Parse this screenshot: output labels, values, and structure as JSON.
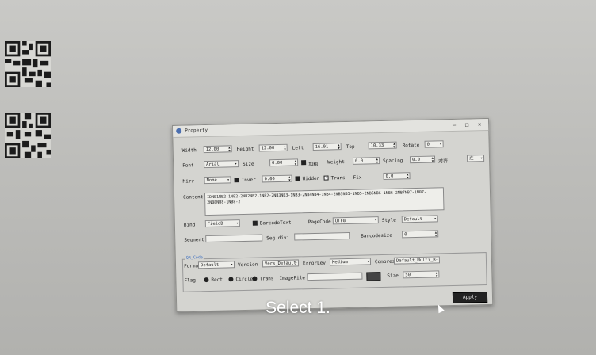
{
  "window": {
    "title": "Property",
    "min": "–",
    "max": "□",
    "close": "×"
  },
  "row1": {
    "width_label": "Width",
    "width_value": "12.00",
    "height_label": "Height",
    "height_value": "12.00",
    "left_label": "Left",
    "left_value": "16.01",
    "top_label": "Top",
    "top_value": "10.33",
    "rotate_label": "Rotate",
    "rotate_value": "0"
  },
  "row2": {
    "font_label": "Font",
    "font_value": "Arial",
    "size_label": "Size",
    "size_value": "0.00",
    "bold_label": "加粗",
    "weight_label": "Weight",
    "weight_value": "0.0",
    "spacing_label": "Spacing",
    "spacing_value": "0.0",
    "align_label": "对齐",
    "align_value": "左"
  },
  "row3": {
    "mirr_label": "Mirr",
    "mirr_value": "None",
    "inver_label": "Inver",
    "inver_value": "0.00",
    "hidden_label": "Hidden",
    "trans_label": "Trans",
    "fix_label": "Fix",
    "fix_value": "0.0"
  },
  "content": {
    "label": "Content",
    "value": "IDNB1NB2-1NB2-2NB2NB2-1NB2-2NB3NB3-1NB3-2NB4NB4-1NB4-2NB5NB5-1NB5-2NB6NB6-1NB6-2NB7NB7-1NB7-2NB8NB8-1NB8-2"
  },
  "row5": {
    "bind_label": "Bind",
    "bind_value": "FieldD",
    "barcodetext_label": "BarcodeText",
    "pagecode_label": "PageCode",
    "pagecode_value": "UTF8",
    "style_label": "Style",
    "style_value": "Default"
  },
  "row6": {
    "segment_label": "Segment",
    "segment_value": "",
    "segdivi_label": "Seg divi",
    "segdivi_value": "",
    "barcodesize_label": "Barcodesize",
    "barcodesize_value": "0"
  },
  "qr_group": {
    "title": "QR_Code",
    "format_label": "Format",
    "format_value": "Default",
    "version_label": "Version",
    "version_value": "Vers_Default",
    "errorlev_label": "ErrorLev",
    "errorlev_value": "Medium",
    "compress_label": "Compress",
    "compress_value": "Default_Multi_B",
    "flag_label": "Flag",
    "rect_label": "Rect",
    "circle_label": "Circle",
    "trans_label": "Trans",
    "imagefile_label": "ImageFile",
    "imagefile_value": "",
    "size_label": "Size",
    "size_value": "50"
  },
  "apply_label": "Apply",
  "subtitle": "Select 1."
}
